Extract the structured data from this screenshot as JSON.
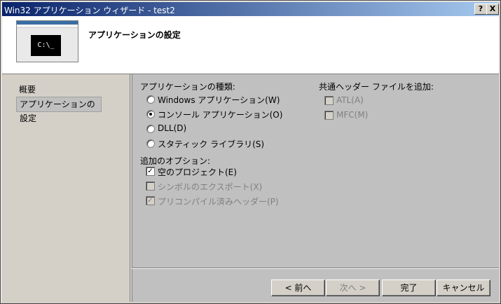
{
  "window": {
    "title": "Win32 アプリケーション ウィザード - test2",
    "help_label": "?",
    "close_label": "X"
  },
  "header": {
    "title": "アプリケーションの設定",
    "thumb_text": "C:\\_"
  },
  "nav": {
    "items": [
      {
        "label": "概要"
      },
      {
        "label": "アプリケーションの設定"
      }
    ]
  },
  "app_type": {
    "heading": "アプリケーションの種類:",
    "options": [
      {
        "label": "Windows アプリケーション(W)"
      },
      {
        "label": "コンソール アプリケーション(O)"
      },
      {
        "label": "DLL(D)"
      },
      {
        "label": "スタティック ライブラリ(S)"
      }
    ]
  },
  "extra_options": {
    "heading": "追加のオプション:",
    "items": [
      {
        "label": "空のプロジェクト(E)"
      },
      {
        "label": "シンボルのエクスポート(X)"
      },
      {
        "label": "プリコンパイル済みヘッダー(P)"
      }
    ]
  },
  "common_headers": {
    "heading": "共通ヘッダー ファイルを追加:",
    "items": [
      {
        "label": "ATL(A)"
      },
      {
        "label": "MFC(M)"
      }
    ]
  },
  "buttons": {
    "back": "< 前へ",
    "next": "次へ >",
    "finish": "完了",
    "cancel": "キャンセル"
  }
}
